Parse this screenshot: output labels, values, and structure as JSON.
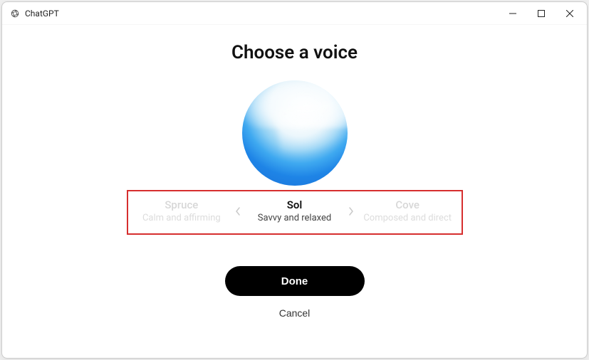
{
  "window": {
    "title": "ChatGPT"
  },
  "heading": "Choose a voice",
  "voices": [
    {
      "name": "Spruce",
      "desc": "Calm and affirming"
    },
    {
      "name": "Sol",
      "desc": "Savvy and relaxed"
    },
    {
      "name": "Cove",
      "desc": "Composed and direct"
    }
  ],
  "buttons": {
    "done": "Done",
    "cancel": "Cancel"
  }
}
